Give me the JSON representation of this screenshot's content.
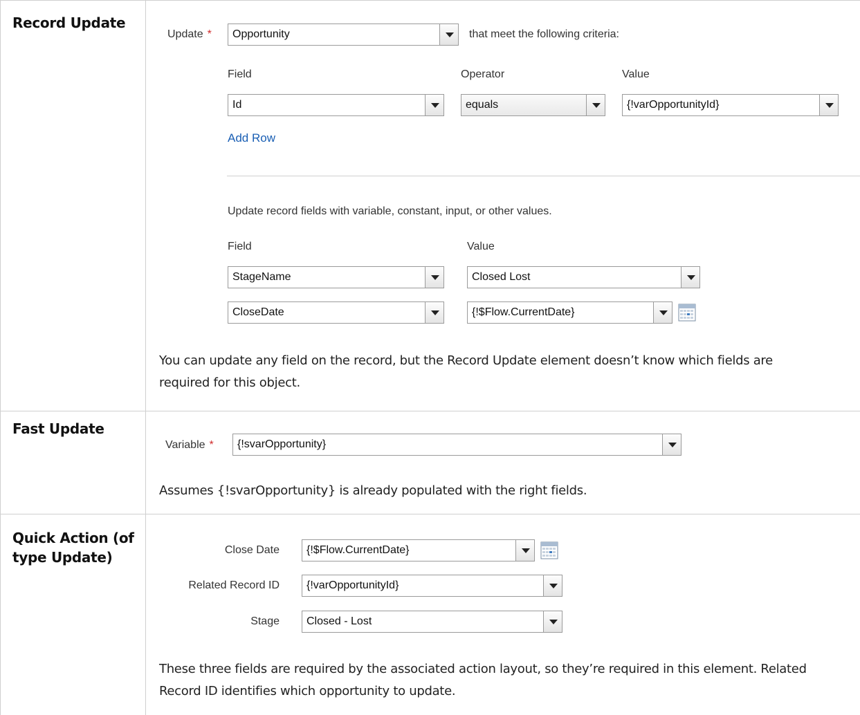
{
  "record_update": {
    "heading": "Record Update",
    "update_label": "Update",
    "update_object": "Opportunity",
    "criteria_text": "that meet the following criteria:",
    "criteria_headers": {
      "field": "Field",
      "operator": "Operator",
      "value": "Value"
    },
    "criteria_row": {
      "field": "Id",
      "operator": "equals",
      "value": "{!varOpportunityId}"
    },
    "add_row": "Add Row",
    "assign_text": "Update record fields with variable, constant, input, or other values.",
    "assign_headers": {
      "field": "Field",
      "value": "Value"
    },
    "assign_rows": [
      {
        "field": "StageName",
        "value": "Closed Lost"
      },
      {
        "field": "CloseDate",
        "value": "{!$Flow.CurrentDate}"
      }
    ],
    "note_line1": "You can update any field on the record, but the Record Update element doesn’t know which fields are",
    "note_line2": "required for this object."
  },
  "fast_update": {
    "heading": "Fast Update",
    "variable_label": "Variable",
    "variable_value": "{!svarOpportunity}",
    "note": "Assumes {!svarOpportunity} is already populated with the right fields."
  },
  "quick_action": {
    "heading_line1": "Quick Action (of",
    "heading_line2": "type Update)",
    "fields": [
      {
        "label": "Close Date",
        "value": "{!$Flow.CurrentDate}"
      },
      {
        "label": "Related Record ID",
        "value": "{!varOpportunityId}"
      },
      {
        "label": "Stage",
        "value": "Closed - Lost"
      }
    ],
    "note_line1": "These three fields are required by the associated action layout, so they’re required in this element. Related",
    "note_line2": "Record ID identifies which opportunity to update."
  },
  "required_marker": "*",
  "colors": {
    "required": "#d02b2b",
    "link": "#1a5fb4",
    "border": "#cfcfcf"
  }
}
